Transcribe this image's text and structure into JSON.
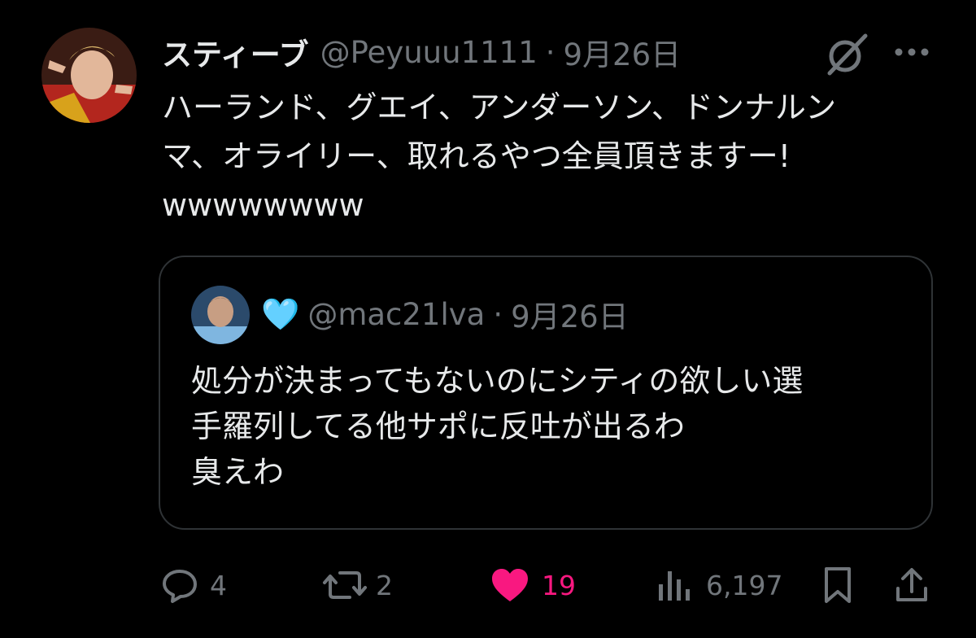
{
  "tweet": {
    "author_name": "スティーブ",
    "handle": "@Peyuuu1111",
    "separator": "·",
    "date": "9月26日",
    "text": "ハーランド、グエイ、アンダーソン、ドンナルン\nマ、オライリー、取れるやつ全員頂きますー!\nwwwwwwww"
  },
  "quoted_tweet": {
    "badge": "🩵",
    "handle": "@mac21lva",
    "separator": "·",
    "date": "9月26日",
    "text": "処分が決まってもないのにシティの欲しい選\n手羅列してる他サポに反吐が出るわ\n臭えわ"
  },
  "actions": {
    "replies": "4",
    "reposts": "2",
    "likes": "19",
    "views": "6,197"
  },
  "icons": {
    "grok": "grok-icon",
    "more": "more-icon",
    "reply": "reply-icon",
    "repost": "repost-icon",
    "like": "heart-icon",
    "views": "views-icon",
    "bookmark": "bookmark-icon",
    "share": "share-icon"
  },
  "colors": {
    "background": "#000000",
    "text": "#e7e9ea",
    "secondary": "#71767b",
    "like": "#f91880",
    "border": "#2f3336"
  }
}
